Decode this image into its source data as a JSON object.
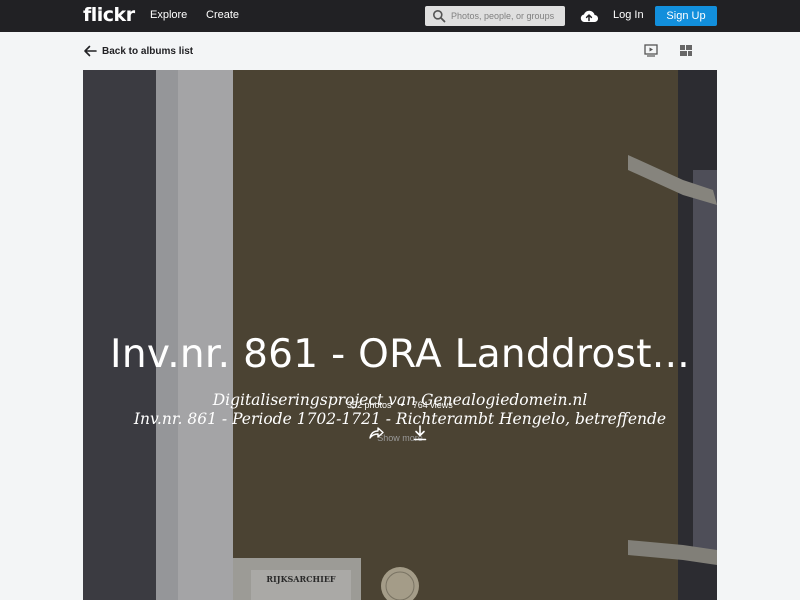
{
  "nav": {
    "logo": "flickr",
    "explore": "Explore",
    "create": "Create",
    "search_placeholder": "Photos, people, or groups",
    "login": "Log In",
    "signup": "Sign Up"
  },
  "subbar": {
    "back_label": "Back to albums list"
  },
  "album": {
    "title": "Inv.nr. 861 - ORA Landdrost...",
    "description_line1": "Digitaliseringsproject van Genealogiedomein.nl",
    "description_line2": "Inv.nr. 861 - Periode 1702-1721 - Richterambt Hengelo, betreffende",
    "show_more": "Show more",
    "photos": "352 photos",
    "separator": "•",
    "views": "764 views",
    "label_text": "RIJKSARCHIEF"
  },
  "colors": {
    "nav_bg": "#212124",
    "accent": "#128fdc",
    "page_bg": "#f3f5f6"
  },
  "icons": [
    "search-icon",
    "upload-cloud-icon",
    "back-arrow-icon",
    "slideshow-icon",
    "grid-icon",
    "single-view-icon",
    "share-icon",
    "download-icon"
  ]
}
